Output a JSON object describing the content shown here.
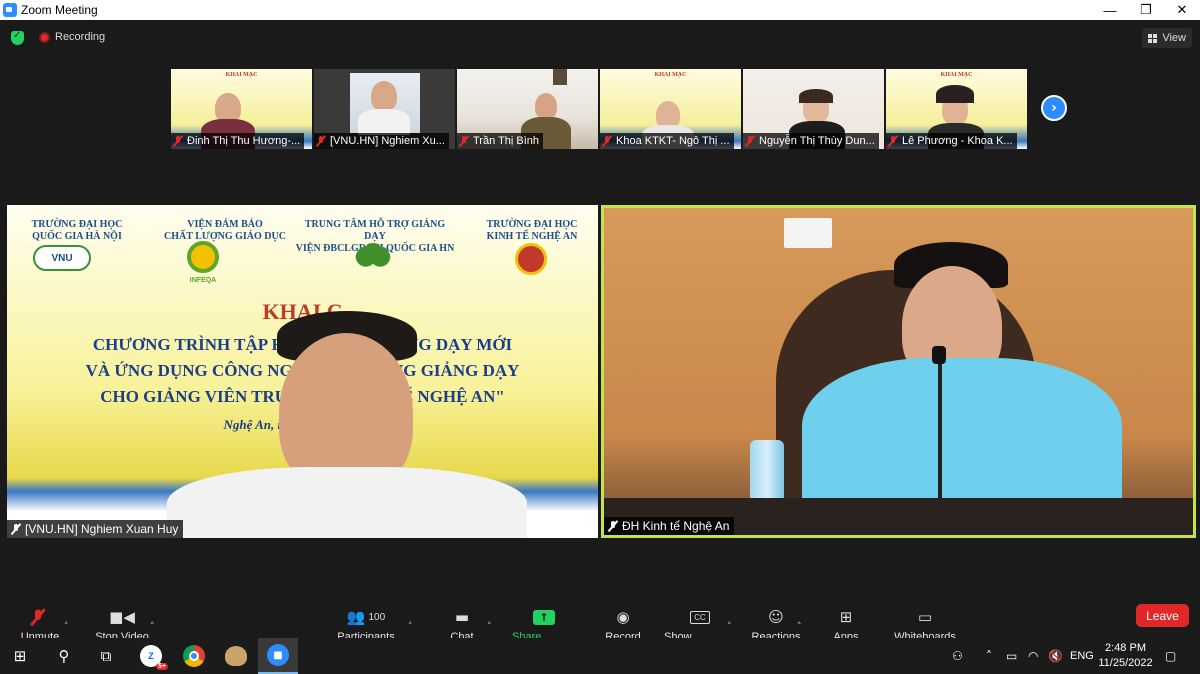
{
  "window": {
    "title": "Zoom Meeting",
    "controls": [
      "—",
      "❐",
      "✕"
    ]
  },
  "topbar": {
    "recording_label": "Recording",
    "view_label": "View"
  },
  "thumbnails": [
    {
      "name": "Đinh Thị Thu Hương-...",
      "scene": "poster",
      "poster_text": "KHAI MẠC"
    },
    {
      "name": "[VNU.HN] Nghiem Xu...",
      "scene": "office"
    },
    {
      "name": "Trần Thị Bình",
      "scene": "room"
    },
    {
      "name": "Khoa KTKT- Ngô Thị ...",
      "scene": "poster",
      "poster_text": "KHAI MẠC"
    },
    {
      "name": "Nguyễn Thị Thùy Dun...",
      "scene": "room"
    },
    {
      "name": "Lê Phương - Khoa K...",
      "scene": "poster",
      "poster_text": "KHAI MẠC"
    }
  ],
  "speakers": {
    "left": {
      "name": "[VNU.HN] Nghiem Xuan Huy",
      "poster": {
        "org1": "TRƯỜNG ĐẠI HỌC\nQUỐC GIA HÀ NỘI",
        "org2": "VIỆN ĐẢM BẢO\nCHẤT LƯỢNG GIÁO DỤC",
        "org3": "TRUNG TÂM HỖ TRỢ GIẢNG DẠY\nVIỆN ĐBCLGD ĐH QUỐC GIA HN",
        "org4": "TRƯỜNG ĐẠI HỌC\nKINH TẾ NGHỆ AN",
        "logo1": "VNU",
        "logo2": "INFEQA",
        "heading": "KHAI   C",
        "line1": "CHƯƠNG TRÌNH TẬP HUẤ            P GIẢNG DẠY MỚI",
        "line2": "VÀ ỨNG DỤNG CÔNG NGH              RONG GIẢNG DẠY",
        "line3": "CHO GIẢNG VIÊN TRƯỜ              NH TẾ NGHỆ AN\"",
        "date": "Nghệ An, ngày                    22"
      }
    },
    "right": {
      "name": "ĐH Kinh tế Nghệ An"
    }
  },
  "controls": {
    "unmute": "Unmute",
    "stop_video": "Stop Video",
    "participants": "Participants",
    "participants_count": "100",
    "chat": "Chat",
    "share_screen": "Share Screen",
    "record": "Record",
    "show_captions": "Show Captions",
    "reactions": "Reactions",
    "apps": "Apps",
    "whiteboards": "Whiteboards",
    "leave": "Leave"
  },
  "taskbar": {
    "language": "ENG",
    "time": "2:48 PM",
    "date": "11/25/2022",
    "zalo_badge": "5+"
  },
  "colors": {
    "accent": "#2d8cff",
    "share_green": "#23d160",
    "leave_red": "#e02828",
    "active_speaker_border": "#c3e34c"
  }
}
